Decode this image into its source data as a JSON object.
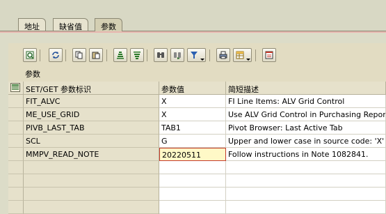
{
  "tabs": [
    {
      "label": "地址",
      "active": false
    },
    {
      "label": "缺省值",
      "active": false
    },
    {
      "label": "参数",
      "active": true
    }
  ],
  "toolbar": {
    "buttons": [
      "details-icon",
      "refresh-icon",
      "copy-icon",
      "paste-icon",
      "sort-ascending-icon",
      "sort-descending-icon",
      "find-icon",
      "find-next-icon",
      "filter-icon",
      "print-icon",
      "export-icon",
      "layout-icon"
    ]
  },
  "grid": {
    "caption": "参数",
    "columns": [
      "SET/GET 参数标识",
      "参数值",
      "简短描述"
    ],
    "rows": [
      {
        "id": "FIT_ALVC",
        "value": "X",
        "desc": "FI Line Items: ALV Grid Control"
      },
      {
        "id": "ME_USE_GRID",
        "value": "X",
        "desc": "Use ALV Grid Control in Purchasing Report"
      },
      {
        "id": "PIVB_LAST_TAB",
        "value": "TAB1",
        "desc": "Pivot Browser: Last Active Tab"
      },
      {
        "id": "SCL",
        "value": "G",
        "desc": "Upper and lower case in source code: 'X'"
      },
      {
        "id": "MMPV_READ_NOTE",
        "value": "20220511",
        "desc": "Follow instructions in Note 1082841."
      }
    ],
    "empty_rows": 4,
    "active_cell": {
      "row": 4,
      "col": "value"
    }
  },
  "colors": {
    "background": "#dcdcc8",
    "header": "#e6e1cb",
    "edit_cell": "#fff9c7",
    "edit_border": "#c43a2a"
  }
}
